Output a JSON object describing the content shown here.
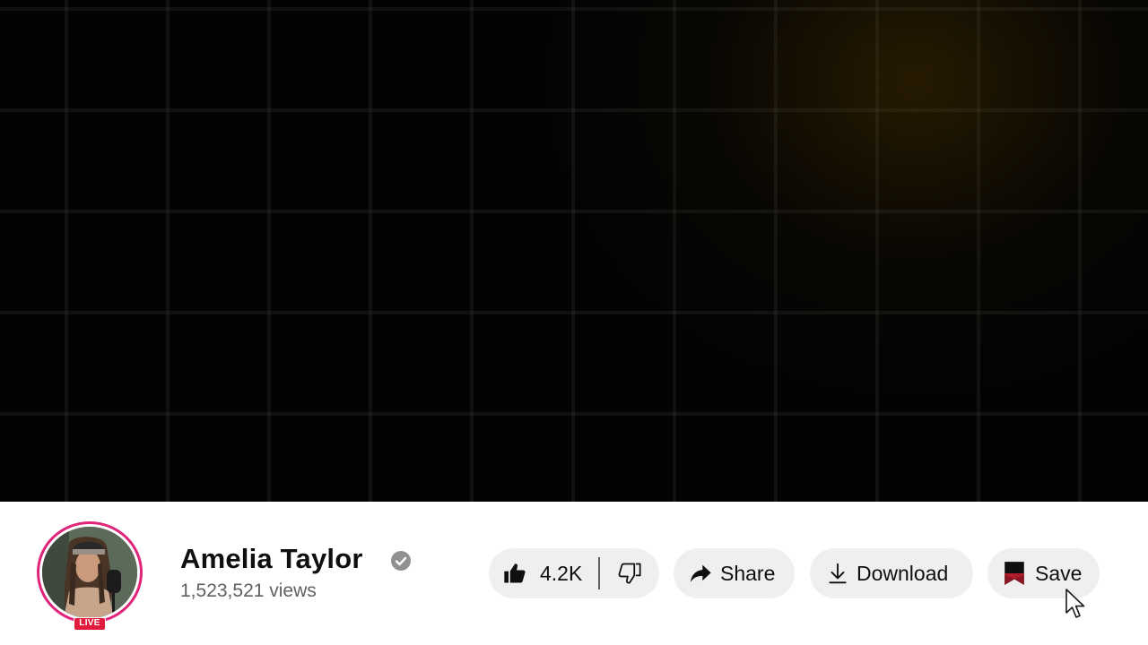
{
  "video": {
    "accent_color": "#7a5200"
  },
  "channel": {
    "name": "Amelia Taylor",
    "views": "1,523,521 views",
    "verified_icon": "verified-check-icon",
    "live_badge": "LIVE",
    "ring_color": "#e0247a"
  },
  "actions": {
    "like_count": "4.2K",
    "like_icon": "thumbs-up-icon",
    "dislike_icon": "thumbs-down-icon",
    "share_label": "Share",
    "share_icon": "share-arrow-icon",
    "download_label": "Download",
    "download_icon": "download-icon",
    "save_label": "Save",
    "save_icon": "bookmark-icon"
  },
  "colors": {
    "pill_background": "#efefef",
    "text_primary": "#0f0f0f",
    "text_secondary": "#606060",
    "live_red": "#e21b3c",
    "bookmark_red": "#8b1520"
  }
}
